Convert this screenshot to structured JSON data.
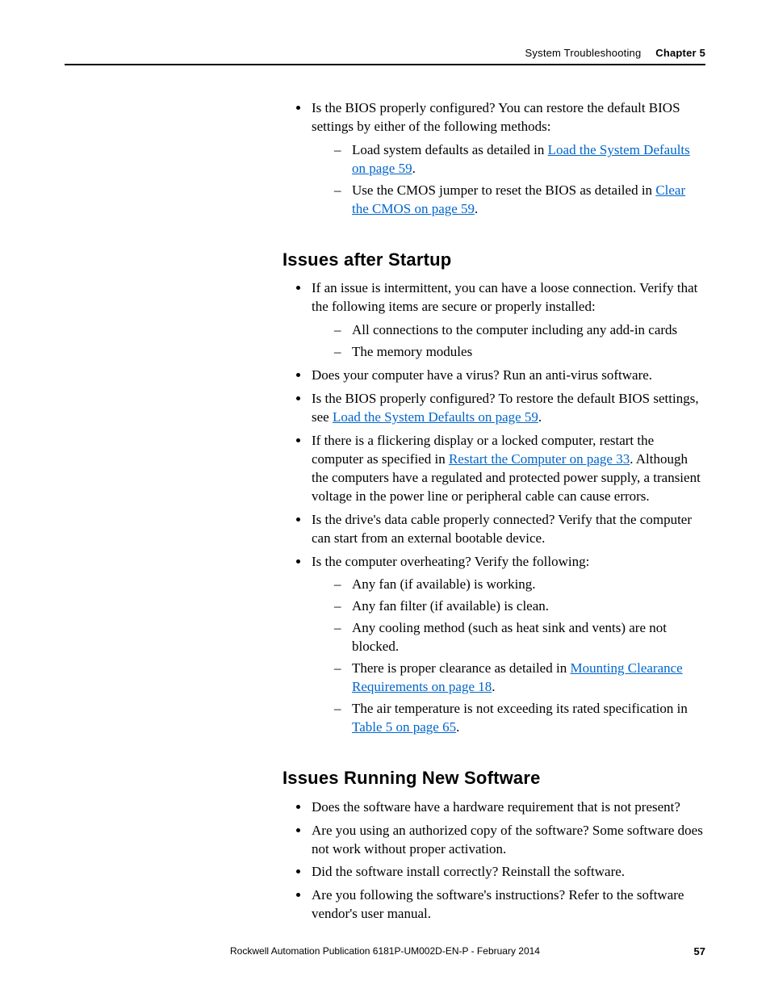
{
  "header": {
    "section_title": "System Troubleshooting",
    "chapter_label": "Chapter 5"
  },
  "intro": {
    "bios_question": "Is the BIOS properly configured? You can restore the default BIOS settings by either of the following methods:",
    "load_defaults_prefix": "Load system defaults as detailed in ",
    "load_defaults_link": "Load the System Defaults on page 59",
    "load_defaults_suffix": ".",
    "cmos_prefix": "Use the CMOS jumper to reset the BIOS as detailed in ",
    "cmos_link": "Clear the CMOS on page 59",
    "cmos_suffix": "."
  },
  "startup": {
    "heading": "Issues after Startup",
    "b1": "If an issue is intermittent, you can have a loose connection. Verify that the following items are secure or properly installed:",
    "b1d1": "All connections to the computer including any add-in cards",
    "b1d2": "The memory modules",
    "b2": "Does your computer have a virus? Run an anti-virus software.",
    "b3_prefix": "Is the BIOS properly configured? To restore the default BIOS settings, see ",
    "b3_link": "Load the System Defaults on page 59",
    "b3_suffix": ".",
    "b4_prefix": "If there is a flickering display or a locked computer, restart the computer as specified in ",
    "b4_link": "Restart the Computer on page 33",
    "b4_suffix": ". Although the computers have a regulated and protected power supply, a transient voltage in the power line or peripheral cable can cause errors.",
    "b5": "Is the drive's data cable properly connected? Verify that the computer can start from an external bootable device.",
    "b6": "Is the computer overheating? Verify the following:",
    "b6d1": "Any fan (if available) is working.",
    "b6d2": "Any fan filter (if available) is clean.",
    "b6d3": "Any cooling method (such as heat sink and vents) are not blocked.",
    "b6d4_prefix": "There is proper clearance as detailed in ",
    "b6d4_link": "Mounting Clearance Requirements on page 18",
    "b6d4_suffix": ".",
    "b6d5_prefix": "The air temperature is not exceeding its rated specification in ",
    "b6d5_link": "Table 5 on page 65",
    "b6d5_suffix": "."
  },
  "software": {
    "heading": "Issues Running New Software",
    "b1": "Does the software have a hardware requirement that is not present?",
    "b2": "Are you using an authorized copy of the software? Some software does not work without proper activation.",
    "b3": "Did the software install correctly? Reinstall the software.",
    "b4": "Are you following the software's instructions? Refer to the software vendor's user manual."
  },
  "footer": {
    "pubinfo": "Rockwell Automation Publication 6181P-UM002D-EN-P - February 2014",
    "page_number": "57"
  }
}
